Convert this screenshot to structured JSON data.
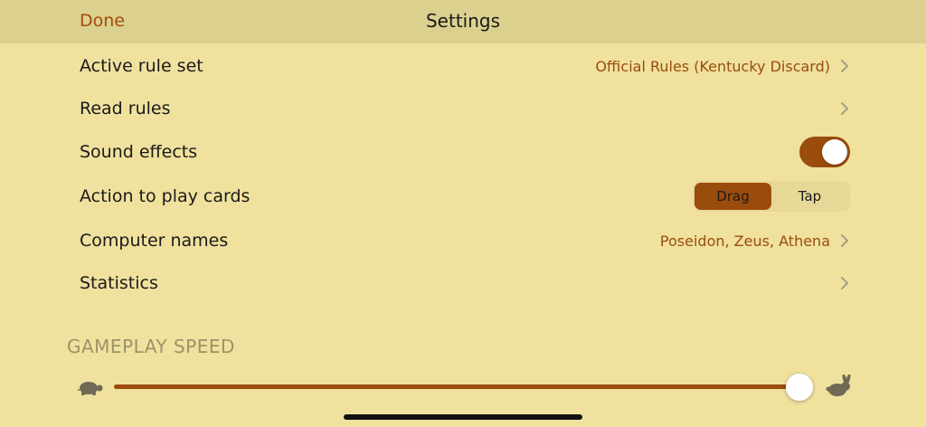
{
  "nav": {
    "done_label": "Done",
    "title": "Settings"
  },
  "rows": [
    {
      "label": "Active rule set",
      "value": "Official Rules (Kentucky Discard)",
      "icon": "chevron-right-icon"
    },
    {
      "label": "Read rules",
      "value": "",
      "icon": "chevron-right-icon"
    },
    {
      "label": "Sound effects",
      "toggle_on": true
    },
    {
      "label": "Action to play cards",
      "segments": [
        "Drag",
        "Tap"
      ],
      "selected": "Drag"
    },
    {
      "label": "Computer names",
      "value": "Poseidon, Zeus, Athena",
      "icon": "chevron-right-icon"
    },
    {
      "label": "Statistics",
      "value": "",
      "icon": "chevron-right-icon"
    }
  ],
  "gameplay_speed": {
    "header": "GAMEPLAY SPEED",
    "value_fraction": 1.0,
    "min_icon": "turtle-icon",
    "max_icon": "rabbit-icon"
  },
  "colors": {
    "background": "#f0e19e",
    "nav_bar": "#dcd08f",
    "accent": "#9a4c0c",
    "section_header": "#9a9468"
  }
}
